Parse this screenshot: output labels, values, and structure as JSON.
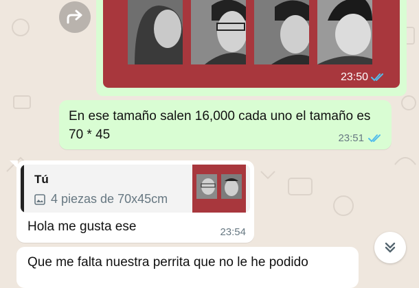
{
  "messages": {
    "image_message": {
      "time": "23:50"
    },
    "outgoing_text": {
      "text": "En ese tamaño salen 16,000 cada uno el tamaño es 70 * 45",
      "time": "23:51"
    },
    "reply_message": {
      "quoted_author": "Tú",
      "quoted_description": "4 piezas de 70x45cm",
      "text": "Hola me gusta ese",
      "time": "23:54"
    },
    "last_incoming": {
      "text": "Que me falta nuestra perrita que no le he podido"
    }
  },
  "icons": {
    "forward": "forward-icon",
    "read_receipt": "double-check-icon",
    "image": "image-icon",
    "scroll_down": "double-chevron-down-icon"
  },
  "colors": {
    "outgoing_bubble": "#d9fdd3",
    "incoming_bubble": "#ffffff",
    "chat_background": "#efe7de",
    "frame_red": "#a8373d",
    "read_tick": "#53bdeb"
  }
}
